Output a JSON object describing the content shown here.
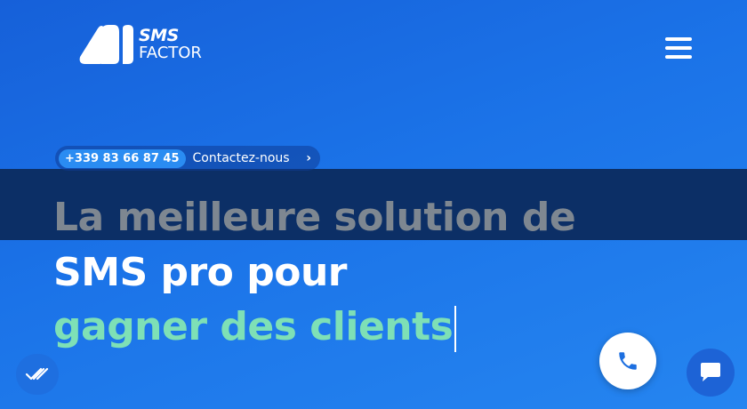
{
  "header": {
    "logo": {
      "line1": "SMS",
      "line2": "FACTOR"
    },
    "menu_icon": "hamburger-menu-icon"
  },
  "contact": {
    "phone": "+339 83 66 87 45",
    "label": "Contactez-nous",
    "chevron": "›"
  },
  "hero": {
    "line1": "La meilleure solution de",
    "line2": "SMS pro pour",
    "line3": "gagner des clients"
  },
  "floating": {
    "call_icon": "phone-icon",
    "chat_icon": "chat-bubble-icon",
    "accessibility_icon": "accessibility-icon"
  },
  "colors": {
    "background": "#1b73e8",
    "band": "#0c2f66",
    "highlight_text": "#7ee0b6",
    "muted_text": "#7e8791",
    "phone_badge": "#2a8cf2"
  }
}
